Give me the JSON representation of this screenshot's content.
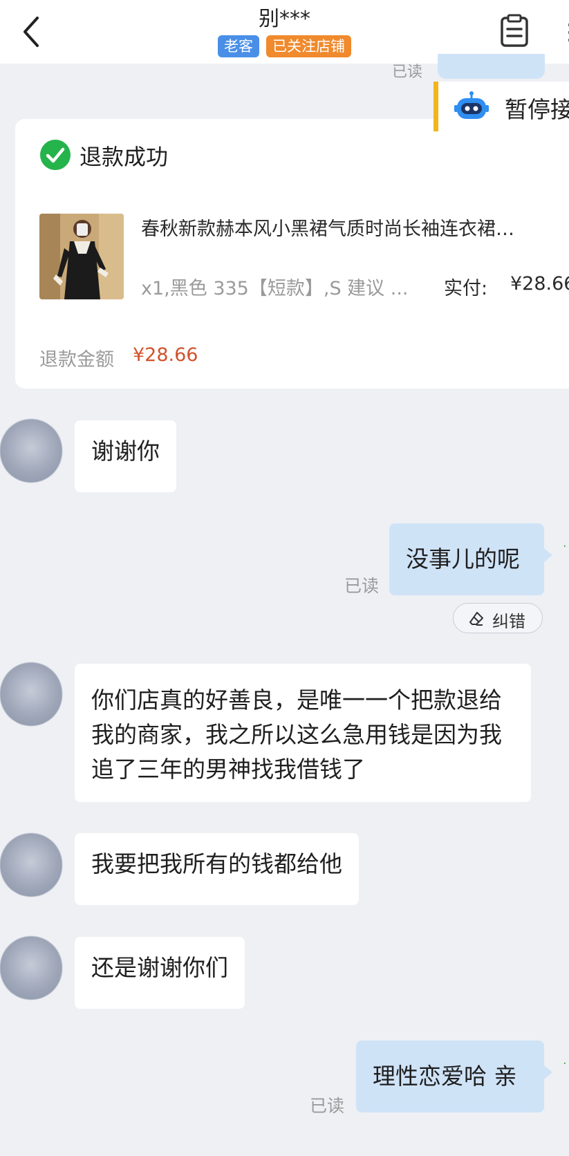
{
  "header": {
    "title": "别***",
    "badges": [
      "老客",
      "已关注店铺"
    ],
    "more_glyph": "⋮"
  },
  "previous": {
    "read_label": "已读"
  },
  "robot_bar": {
    "text": "暂停接"
  },
  "refund_card": {
    "status": "退款成功",
    "product_name": "春秋新款赫本风小黑裙气质时尚长袖连衣裙…",
    "product_spec": "x1,黑色 335【短款】,S 建议 ...",
    "paid_label": "实付:",
    "paid_value": "¥28.66",
    "refund_label": "退款金额",
    "refund_amount": "¥28.66"
  },
  "messages": [
    {
      "side": "in",
      "text": "谢谢你"
    },
    {
      "side": "out",
      "text": "没事儿的呢",
      "read": "已读"
    },
    {
      "side": "in",
      "text": "你们店真的好善良，是唯一一个把款退给我的商家，我之所以这么急用钱是因为我追了三年的男神找我借钱了"
    },
    {
      "side": "in",
      "text": "我要把我所有的钱都给他"
    },
    {
      "side": "in",
      "text": "还是谢谢你们"
    },
    {
      "side": "out",
      "text": "理性恋爱哈 亲",
      "read": "已读"
    }
  ],
  "correct_button": {
    "label": "纠错"
  },
  "colors": {
    "out_bubble": "#cfe3f7",
    "badge_blue": "#4a8fe7",
    "badge_orange": "#f08a2c",
    "success_green": "#25b34b",
    "price_red": "#d0532c",
    "robot_accent": "#f2b51a"
  }
}
